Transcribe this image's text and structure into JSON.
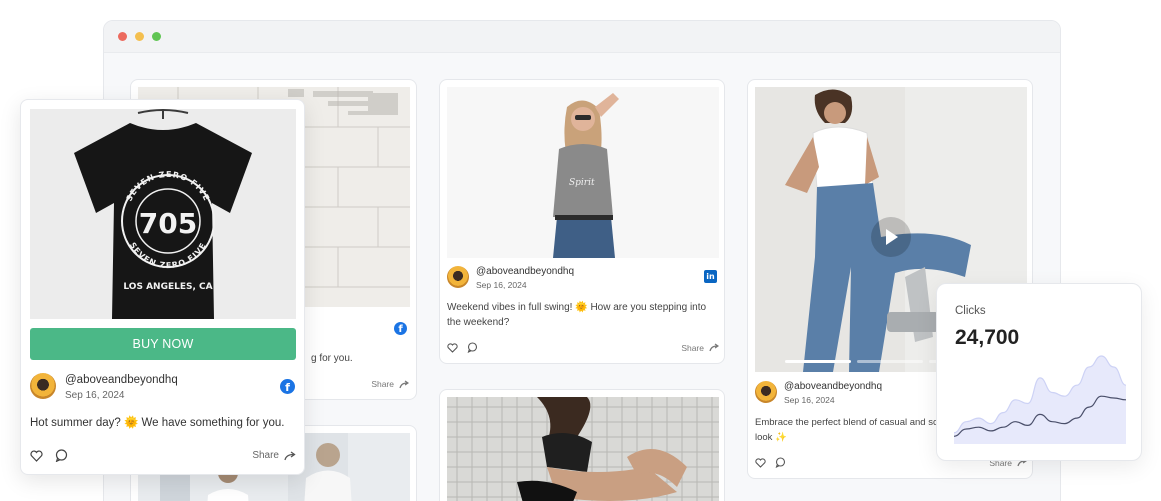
{
  "window": {
    "controls": [
      "close",
      "minimize",
      "maximize"
    ],
    "colors": {
      "close": "#ec6a5e",
      "minimize": "#f4bf4f",
      "maximize": "#61c554"
    }
  },
  "product_card": {
    "shirt_text": {
      "arc_top": "SEVEN ZERO FIVE",
      "number": "705",
      "arc_bottom": "SEVEN ZERO FIVE",
      "city": "LOS ANGELES, CA"
    },
    "buy_label": "BUY NOW",
    "handle": "@aboveandbeyondhq",
    "date": "Sep 16, 2024",
    "caption": "Hot summer day? 🌞 We have something for you.",
    "network_icon": "facebook-icon",
    "share_label": "Share",
    "accent_color": "#4bb887"
  },
  "feed": {
    "col1_top": {
      "caption_visible": "g for you.",
      "share_label": "Share",
      "network_icon": "facebook-icon"
    },
    "col2_top": {
      "handle": "@aboveandbeyondhq",
      "date": "Sep 16, 2024",
      "caption": "Weekend vibes in full swing! 🌞 How are you stepping into the weekend?",
      "network_icon": "linkedin-icon",
      "share_label": "Share"
    },
    "col3_top": {
      "handle": "@aboveandbeyondhq",
      "date": "Sep 16, 2024",
      "caption": "Embrace the perfect blend of casual and sc look ✨",
      "share_label": "Share",
      "has_video": true
    }
  },
  "stats": {
    "label": "Clicks",
    "value": "24,700",
    "series": [
      {
        "name": "",
        "values": [
          4,
          10,
          12,
          9,
          15,
          22,
          20,
          34,
          26,
          24,
          30,
          40,
          46,
          40,
          30
        ]
      },
      {
        "name": "",
        "values": [
          2,
          6,
          7,
          5,
          7,
          10,
          8,
          14,
          10,
          9,
          12,
          18,
          24,
          23,
          22
        ]
      }
    ]
  }
}
